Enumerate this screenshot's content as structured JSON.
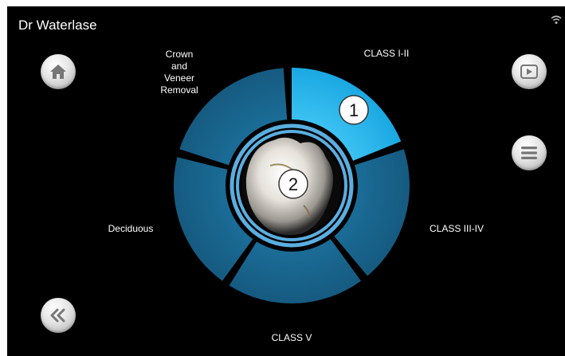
{
  "app": {
    "title": "Dr Waterlase"
  },
  "wheel": {
    "segments": [
      {
        "label": "CLASS I-II",
        "selected": true
      },
      {
        "label": "CLASS III-IV",
        "selected": false
      },
      {
        "label": "CLASS V",
        "selected": false
      },
      {
        "label": "Deciduous",
        "selected": false
      },
      {
        "label": "Crown and Veneer Removal",
        "label_lines": [
          "Crown",
          "and",
          "Veneer",
          "Removal"
        ],
        "selected": false
      }
    ],
    "markers": [
      "1",
      "2"
    ]
  },
  "buttons": {
    "home_icon": "home-icon",
    "play_icon": "play-icon",
    "menu_icon": "menu-icon",
    "back_icon": "double-chevron-left-icon"
  },
  "colors": {
    "segment": "#1a6d98",
    "segment_selected": "#2ab2e8",
    "ring": "#5aaee0",
    "background": "#000000"
  }
}
